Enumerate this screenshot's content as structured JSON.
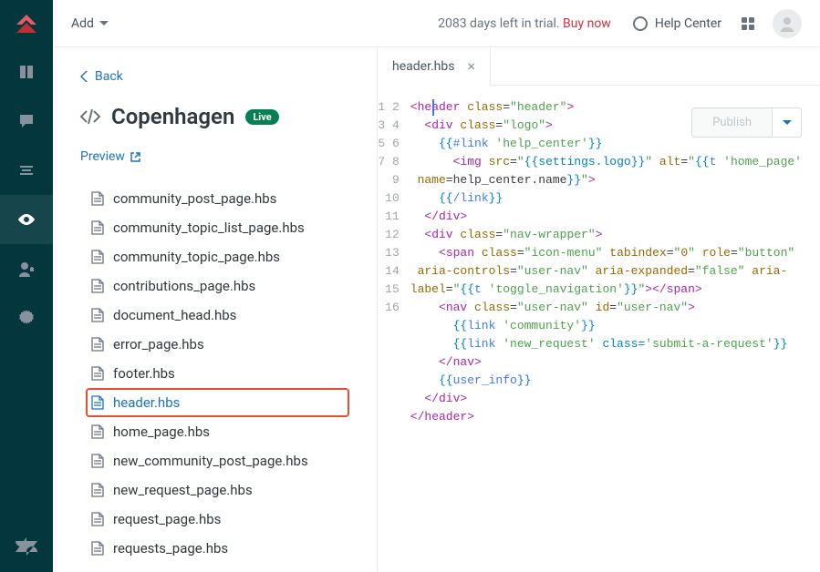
{
  "topbar": {
    "add_label": "Add",
    "trial_text_prefix": "2083 days left in trial. ",
    "trial_link_label": "Buy now",
    "help_center_label": "Help Center"
  },
  "panel": {
    "back_label": "Back",
    "title": "Copenhagen",
    "badge_label": "Live",
    "preview_label": "Preview"
  },
  "files": [
    "community_post_page.hbs",
    "community_topic_list_page.hbs",
    "community_topic_page.hbs",
    "contributions_page.hbs",
    "document_head.hbs",
    "error_page.hbs",
    "footer.hbs",
    "header.hbs",
    "home_page.hbs",
    "new_community_post_page.hbs",
    "new_request_page.hbs",
    "request_page.hbs",
    "requests_page.hbs"
  ],
  "selected_file_index": 7,
  "editor": {
    "tab_label": "header.hbs",
    "publish_label": "Publish",
    "lines": [
      {
        "n": 1,
        "tokens": [
          {
            "t": "<",
            "c": "tag"
          },
          {
            "t": "header",
            "c": "tag"
          },
          {
            "t": " class",
            "c": "attr"
          },
          {
            "t": "=",
            "c": ""
          },
          {
            "t": "\"header\"",
            "c": "str"
          },
          {
            "t": ">",
            "c": "tag"
          }
        ]
      },
      {
        "n": 2,
        "indent": 2,
        "tokens": [
          {
            "t": "<",
            "c": "tag"
          },
          {
            "t": "div",
            "c": "tag"
          },
          {
            "t": " class",
            "c": "attr"
          },
          {
            "t": "=",
            "c": ""
          },
          {
            "t": "\"logo\"",
            "c": "str"
          },
          {
            "t": ">",
            "c": "tag"
          }
        ]
      },
      {
        "n": 3,
        "indent": 4,
        "tokens": [
          {
            "t": "{{",
            "c": "hb"
          },
          {
            "t": "#link",
            "c": "hb-kw"
          },
          {
            "t": " 'help_center'",
            "c": "str"
          },
          {
            "t": "}}",
            "c": "hb"
          }
        ]
      },
      {
        "n": 4,
        "indent": 6,
        "tokens": [
          {
            "t": "<",
            "c": "tag"
          },
          {
            "t": "img",
            "c": "tag"
          },
          {
            "t": " src",
            "c": "attr"
          },
          {
            "t": "=",
            "c": ""
          },
          {
            "t": "\"",
            "c": "str"
          },
          {
            "t": "{{",
            "c": "hb"
          },
          {
            "t": "settings.logo",
            "c": "hb"
          },
          {
            "t": "}}",
            "c": "hb"
          },
          {
            "t": "\"",
            "c": "str"
          },
          {
            "t": " alt",
            "c": "attr"
          },
          {
            "t": "=",
            "c": ""
          },
          {
            "t": "\"",
            "c": "str"
          },
          {
            "t": "{{",
            "c": "hb"
          },
          {
            "t": "t ",
            "c": "hb-kw"
          },
          {
            "t": "'home_page'",
            "c": "str"
          }
        ],
        "wrap": [
          {
            "t": " name",
            "c": "attr"
          },
          {
            "t": "=",
            "c": ""
          },
          {
            "t": "help_center.name",
            "c": ""
          },
          {
            "t": "}}",
            "c": "hb"
          },
          {
            "t": "\"",
            "c": "str"
          },
          {
            "t": ">",
            "c": "tag"
          }
        ]
      },
      {
        "n": 5,
        "indent": 4,
        "tokens": [
          {
            "t": "{{",
            "c": "hb"
          },
          {
            "t": "/link",
            "c": "hb-kw"
          },
          {
            "t": "}}",
            "c": "hb"
          }
        ]
      },
      {
        "n": 6,
        "indent": 2,
        "tokens": [
          {
            "t": "</",
            "c": "tag"
          },
          {
            "t": "div",
            "c": "tag"
          },
          {
            "t": ">",
            "c": "tag"
          }
        ]
      },
      {
        "n": 7,
        "indent": 2,
        "tokens": [
          {
            "t": "<",
            "c": "tag"
          },
          {
            "t": "div",
            "c": "tag"
          },
          {
            "t": " class",
            "c": "attr"
          },
          {
            "t": "=",
            "c": ""
          },
          {
            "t": "\"nav-wrapper\"",
            "c": "str"
          },
          {
            "t": ">",
            "c": "tag"
          }
        ]
      },
      {
        "n": 8,
        "indent": 4,
        "tokens": [
          {
            "t": "<",
            "c": "tag"
          },
          {
            "t": "span",
            "c": "tag"
          },
          {
            "t": " class",
            "c": "attr"
          },
          {
            "t": "=",
            "c": ""
          },
          {
            "t": "\"icon-menu\"",
            "c": "str"
          },
          {
            "t": " tabindex",
            "c": "attr"
          },
          {
            "t": "=",
            "c": ""
          },
          {
            "t": "\"",
            "c": "str"
          },
          {
            "t": "0",
            "c": "num"
          },
          {
            "t": "\"",
            "c": "str"
          },
          {
            "t": " role",
            "c": "attr"
          },
          {
            "t": "=",
            "c": ""
          },
          {
            "t": "\"button\"",
            "c": "str"
          }
        ],
        "wrap": [
          {
            "t": " aria-controls",
            "c": "attr"
          },
          {
            "t": "=",
            "c": ""
          },
          {
            "t": "\"user-nav\"",
            "c": "str"
          },
          {
            "t": " aria-expanded",
            "c": "attr"
          },
          {
            "t": "=",
            "c": ""
          },
          {
            "t": "\"false\"",
            "c": "str"
          },
          {
            "t": " aria-",
            "c": "attr"
          }
        ],
        "wrap2": [
          {
            "t": "label",
            "c": "attr"
          },
          {
            "t": "=",
            "c": ""
          },
          {
            "t": "\"",
            "c": "str"
          },
          {
            "t": "{{",
            "c": "hb"
          },
          {
            "t": "t ",
            "c": "hb-kw"
          },
          {
            "t": "'toggle_navigation'",
            "c": "str"
          },
          {
            "t": "}}",
            "c": "hb"
          },
          {
            "t": "\"",
            "c": "str"
          },
          {
            "t": "></",
            "c": "tag"
          },
          {
            "t": "span",
            "c": "tag"
          },
          {
            "t": ">",
            "c": "tag"
          }
        ]
      },
      {
        "n": 9,
        "indent": 4,
        "tokens": [
          {
            "t": "<",
            "c": "tag"
          },
          {
            "t": "nav",
            "c": "tag"
          },
          {
            "t": " class",
            "c": "attr"
          },
          {
            "t": "=",
            "c": ""
          },
          {
            "t": "\"user-nav\"",
            "c": "str"
          },
          {
            "t": " id",
            "c": "attr"
          },
          {
            "t": "=",
            "c": ""
          },
          {
            "t": "\"user-nav\"",
            "c": "str"
          },
          {
            "t": ">",
            "c": "tag"
          }
        ]
      },
      {
        "n": 10,
        "indent": 6,
        "tokens": [
          {
            "t": "{{",
            "c": "hb"
          },
          {
            "t": "link ",
            "c": "hb-kw"
          },
          {
            "t": "'community'",
            "c": "str"
          },
          {
            "t": "}}",
            "c": "hb"
          }
        ]
      },
      {
        "n": 11,
        "indent": 6,
        "tokens": [
          {
            "t": "{{",
            "c": "hb"
          },
          {
            "t": "link ",
            "c": "hb-kw"
          },
          {
            "t": "'new_request'",
            "c": "str"
          },
          {
            "t": " class",
            "c": "hb"
          },
          {
            "t": "=",
            "c": "hb"
          },
          {
            "t": "'submit-a-request'",
            "c": "str"
          },
          {
            "t": "}}",
            "c": "hb"
          }
        ]
      },
      {
        "n": 12,
        "indent": 4,
        "tokens": [
          {
            "t": "</",
            "c": "tag"
          },
          {
            "t": "nav",
            "c": "tag"
          },
          {
            "t": ">",
            "c": "tag"
          }
        ]
      },
      {
        "n": 13,
        "indent": 4,
        "tokens": [
          {
            "t": "{{",
            "c": "hb"
          },
          {
            "t": "user_info",
            "c": "hb-kw"
          },
          {
            "t": "}}",
            "c": "hb"
          }
        ]
      },
      {
        "n": 14,
        "indent": 2,
        "tokens": [
          {
            "t": "</",
            "c": "tag"
          },
          {
            "t": "div",
            "c": "tag"
          },
          {
            "t": ">",
            "c": "tag"
          }
        ]
      },
      {
        "n": 15,
        "indent": 0,
        "tokens": [
          {
            "t": "</",
            "c": "tag"
          },
          {
            "t": "header",
            "c": "tag"
          },
          {
            "t": ">",
            "c": "tag"
          }
        ]
      },
      {
        "n": 16,
        "indent": 0,
        "tokens": []
      }
    ]
  }
}
